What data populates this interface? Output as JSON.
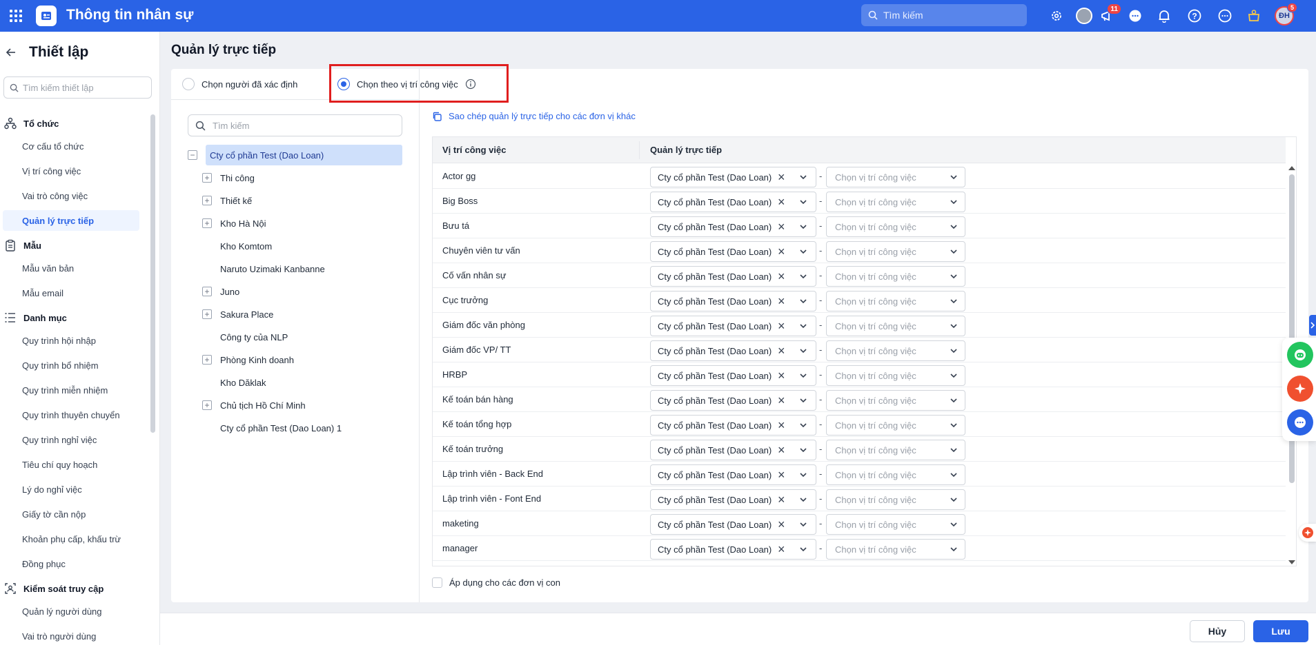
{
  "app": {
    "title": "Thông tin nhân sự"
  },
  "topbar": {
    "search_placeholder": "Tìm kiếm",
    "notifications_badge": "11",
    "avatar_initials": "ĐH",
    "avatar_badge": "5"
  },
  "sidebar": {
    "title": "Thiết lập",
    "search_placeholder": "Tìm kiếm thiết lập",
    "groups": [
      {
        "label": "Tổ chức",
        "icon": "org-chart-icon",
        "items": [
          "Cơ cấu tổ chức",
          "Vị trí công việc",
          "Vai trò công việc",
          "Quản lý trực tiếp"
        ]
      },
      {
        "label": "Mẫu",
        "icon": "clipboard-icon",
        "items": [
          "Mẫu văn bản",
          "Mẫu email"
        ]
      },
      {
        "label": "Danh mục",
        "icon": "list-icon",
        "items": [
          "Quy trình hội nhập",
          "Quy trình bổ nhiệm",
          "Quy trình miễn nhiệm",
          "Quy trình thuyên chuyển",
          "Quy trình nghỉ việc",
          "Tiêu chí quy hoạch",
          "Lý do nghỉ việc",
          "Giấy tờ cần nộp",
          "Khoản phụ cấp, khấu trừ",
          "Đồng phục"
        ]
      },
      {
        "label": "Kiểm soát truy cập",
        "icon": "access-control-icon",
        "items": [
          "Quản lý người dùng",
          "Vai trò người dùng"
        ]
      }
    ],
    "active_item": "Quản lý trực tiếp"
  },
  "main": {
    "page_title": "Quản lý trực tiếp",
    "mode_options": [
      "Chọn người đã xác định",
      "Chọn theo vị trí công việc"
    ],
    "selected_mode": "Chọn theo vị trí công việc",
    "tree": {
      "search_placeholder": "Tìm kiếm",
      "root": "Cty cổ phần Test (Dao Loan)",
      "children": [
        {
          "label": "Thi công",
          "expandable": true
        },
        {
          "label": "Thiết kế",
          "expandable": true
        },
        {
          "label": "Kho Hà Nội",
          "expandable": true
        },
        {
          "label": "Kho Komtom",
          "expandable": false
        },
        {
          "label": "Naruto Uzimaki Kanbanne",
          "expandable": false
        },
        {
          "label": "Juno",
          "expandable": true
        },
        {
          "label": "Sakura Place",
          "expandable": true
        },
        {
          "label": "Công ty của NLP",
          "expandable": false
        },
        {
          "label": "Phòng Kinh doanh",
          "expandable": true
        },
        {
          "label": "Kho Dăklak",
          "expandable": false
        },
        {
          "label": "Chủ tịch Hồ Chí Minh",
          "expandable": true
        },
        {
          "label": "Cty cổ phần Test (Dao Loan) 1",
          "expandable": false
        }
      ]
    },
    "copy_link": "Sao chép quản lý trực tiếp cho các đơn vị khác",
    "table": {
      "headers": [
        "Vị trí công việc",
        "Quản lý trực tiếp"
      ],
      "manager_value": "Cty cổ phần Test (Dao Loan)",
      "position_placeholder": "Chọn vị trí công việc",
      "rows": [
        "Actor gg",
        "Big Boss",
        "Bưu tá",
        "Chuyên viên tư vấn",
        "Cố vấn nhân sự",
        "Cục trưởng",
        "Giám đốc văn phòng",
        "Giám đốc VP/ TT",
        "HRBP",
        "Kế toán bán hàng",
        "Kế toán tổng hợp",
        "Kế toán trưởng",
        "Lập trình viên - Back End",
        "Lập trình viên - Font End",
        "maketing",
        "manager"
      ]
    },
    "apply_children_label": "Áp dụng cho các đơn vị con"
  },
  "footer": {
    "cancel_label": "Hủy",
    "save_label": "Lưu"
  },
  "colors": {
    "primary": "#2a63e6",
    "highlight": "#e01e1e",
    "badge": "#ef4444"
  }
}
